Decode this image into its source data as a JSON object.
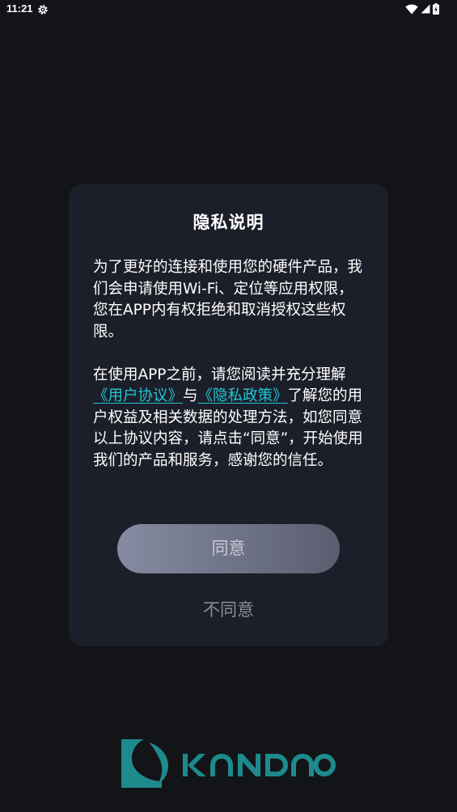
{
  "status_bar": {
    "time": "11:21",
    "icons": [
      "settings-gear-icon",
      "wifi-icon",
      "cellular-signal-icon",
      "battery-icon"
    ]
  },
  "dialog": {
    "title": "隐私说明",
    "paragraph1": "为了更好的连接和使用您的硬件产品，我们会申请使用Wi-Fi、定位等应用权限，您在APP内有权拒绝和取消授权这些权限。",
    "paragraph2_before": "在使用APP之前，请您阅读并充分理解",
    "user_agreement_link": "《用户协议》",
    "paragraph2_between": "与",
    "privacy_policy_link": "《隐私政策》",
    "paragraph2_after": "了解您的用户权益及相关数据的处理方法，如您同意以上协议内容，请点击“同意”，开始使用我们的产品和服务，感谢您的信任。",
    "agree_label": "同意",
    "disagree_label": "不同意"
  },
  "brand": {
    "logo_text": "KANDAO",
    "logo_color": "#1e8a8c"
  },
  "colors": {
    "background": "#131418",
    "dialog_bg": "#1c1f29",
    "link": "#20c6d6"
  }
}
